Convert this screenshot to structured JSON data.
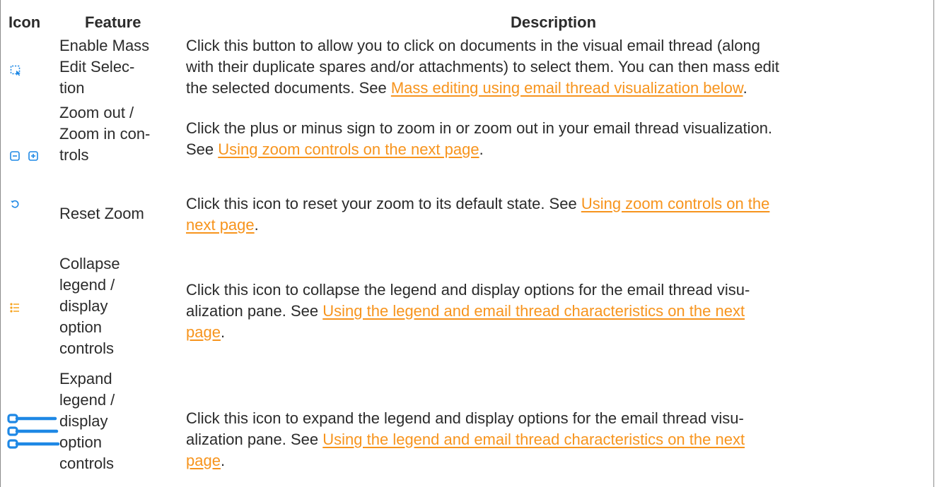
{
  "table": {
    "headers": {
      "icon": "Icon",
      "feature": "Feature",
      "description": "Description"
    },
    "rows": [
      {
        "icon": "mass-edit-select-icon",
        "feature": [
          "Enable Mass",
          "Edit Selec-",
          "tion"
        ],
        "desc_lines": [
          {
            "text": "Click this button to allow you to click on documents in the visual email thread (along"
          },
          {
            "text": "with their duplicate spares and/or attachments) to select them. You can then mass edit"
          },
          {
            "text": "the selected documents. See ",
            "link": "Mass editing using email thread visualization below",
            "after": "."
          }
        ]
      },
      {
        "icon": "zoom-out-zoom-in-icons",
        "feature": [
          "Zoom out /",
          "Zoom in con-",
          "trols"
        ],
        "desc_lines": [
          {
            "text": "Click the plus or minus sign to zoom in or zoom out in your email thread visualization."
          },
          {
            "text": "See ",
            "link": "Using zoom controls on the next page",
            "after": "."
          }
        ]
      },
      {
        "icon": "reset-zoom-icon",
        "feature": [
          "Reset Zoom"
        ],
        "desc_lines": [
          {
            "text": "Click this icon to reset your zoom to its default state. See ",
            "link": "Using zoom controls on the"
          },
          {
            "text": "",
            "link": "next page",
            "after": "."
          }
        ]
      },
      {
        "icon": "collapse-legend-icon",
        "feature": [
          "Collapse",
          "legend /",
          "display",
          "option",
          "controls"
        ],
        "desc_lines": [
          {
            "text": "Click this icon to collapse the legend and display options for the email thread visu-"
          },
          {
            "text": "alization pane. See ",
            "link": "Using the legend and email thread characteristics on the next"
          },
          {
            "text": "",
            "link": "page",
            "after": "."
          }
        ]
      },
      {
        "icon": "expand-legend-icon",
        "feature": [
          "Expand",
          "legend /",
          "display",
          "option",
          "controls"
        ],
        "desc_lines": [
          {
            "text": "Click this icon to expand the legend and display options for the email thread visu-"
          },
          {
            "text": "alization pane. See ",
            "link": "Using the legend and email thread characteristics on the next"
          },
          {
            "text": "",
            "link": "page",
            "after": "."
          }
        ]
      }
    ]
  },
  "colors": {
    "link": "#f7941d",
    "icon_blue": "#1e88e5",
    "icon_orange": "#f7a21b",
    "text": "#2b2b2b"
  }
}
